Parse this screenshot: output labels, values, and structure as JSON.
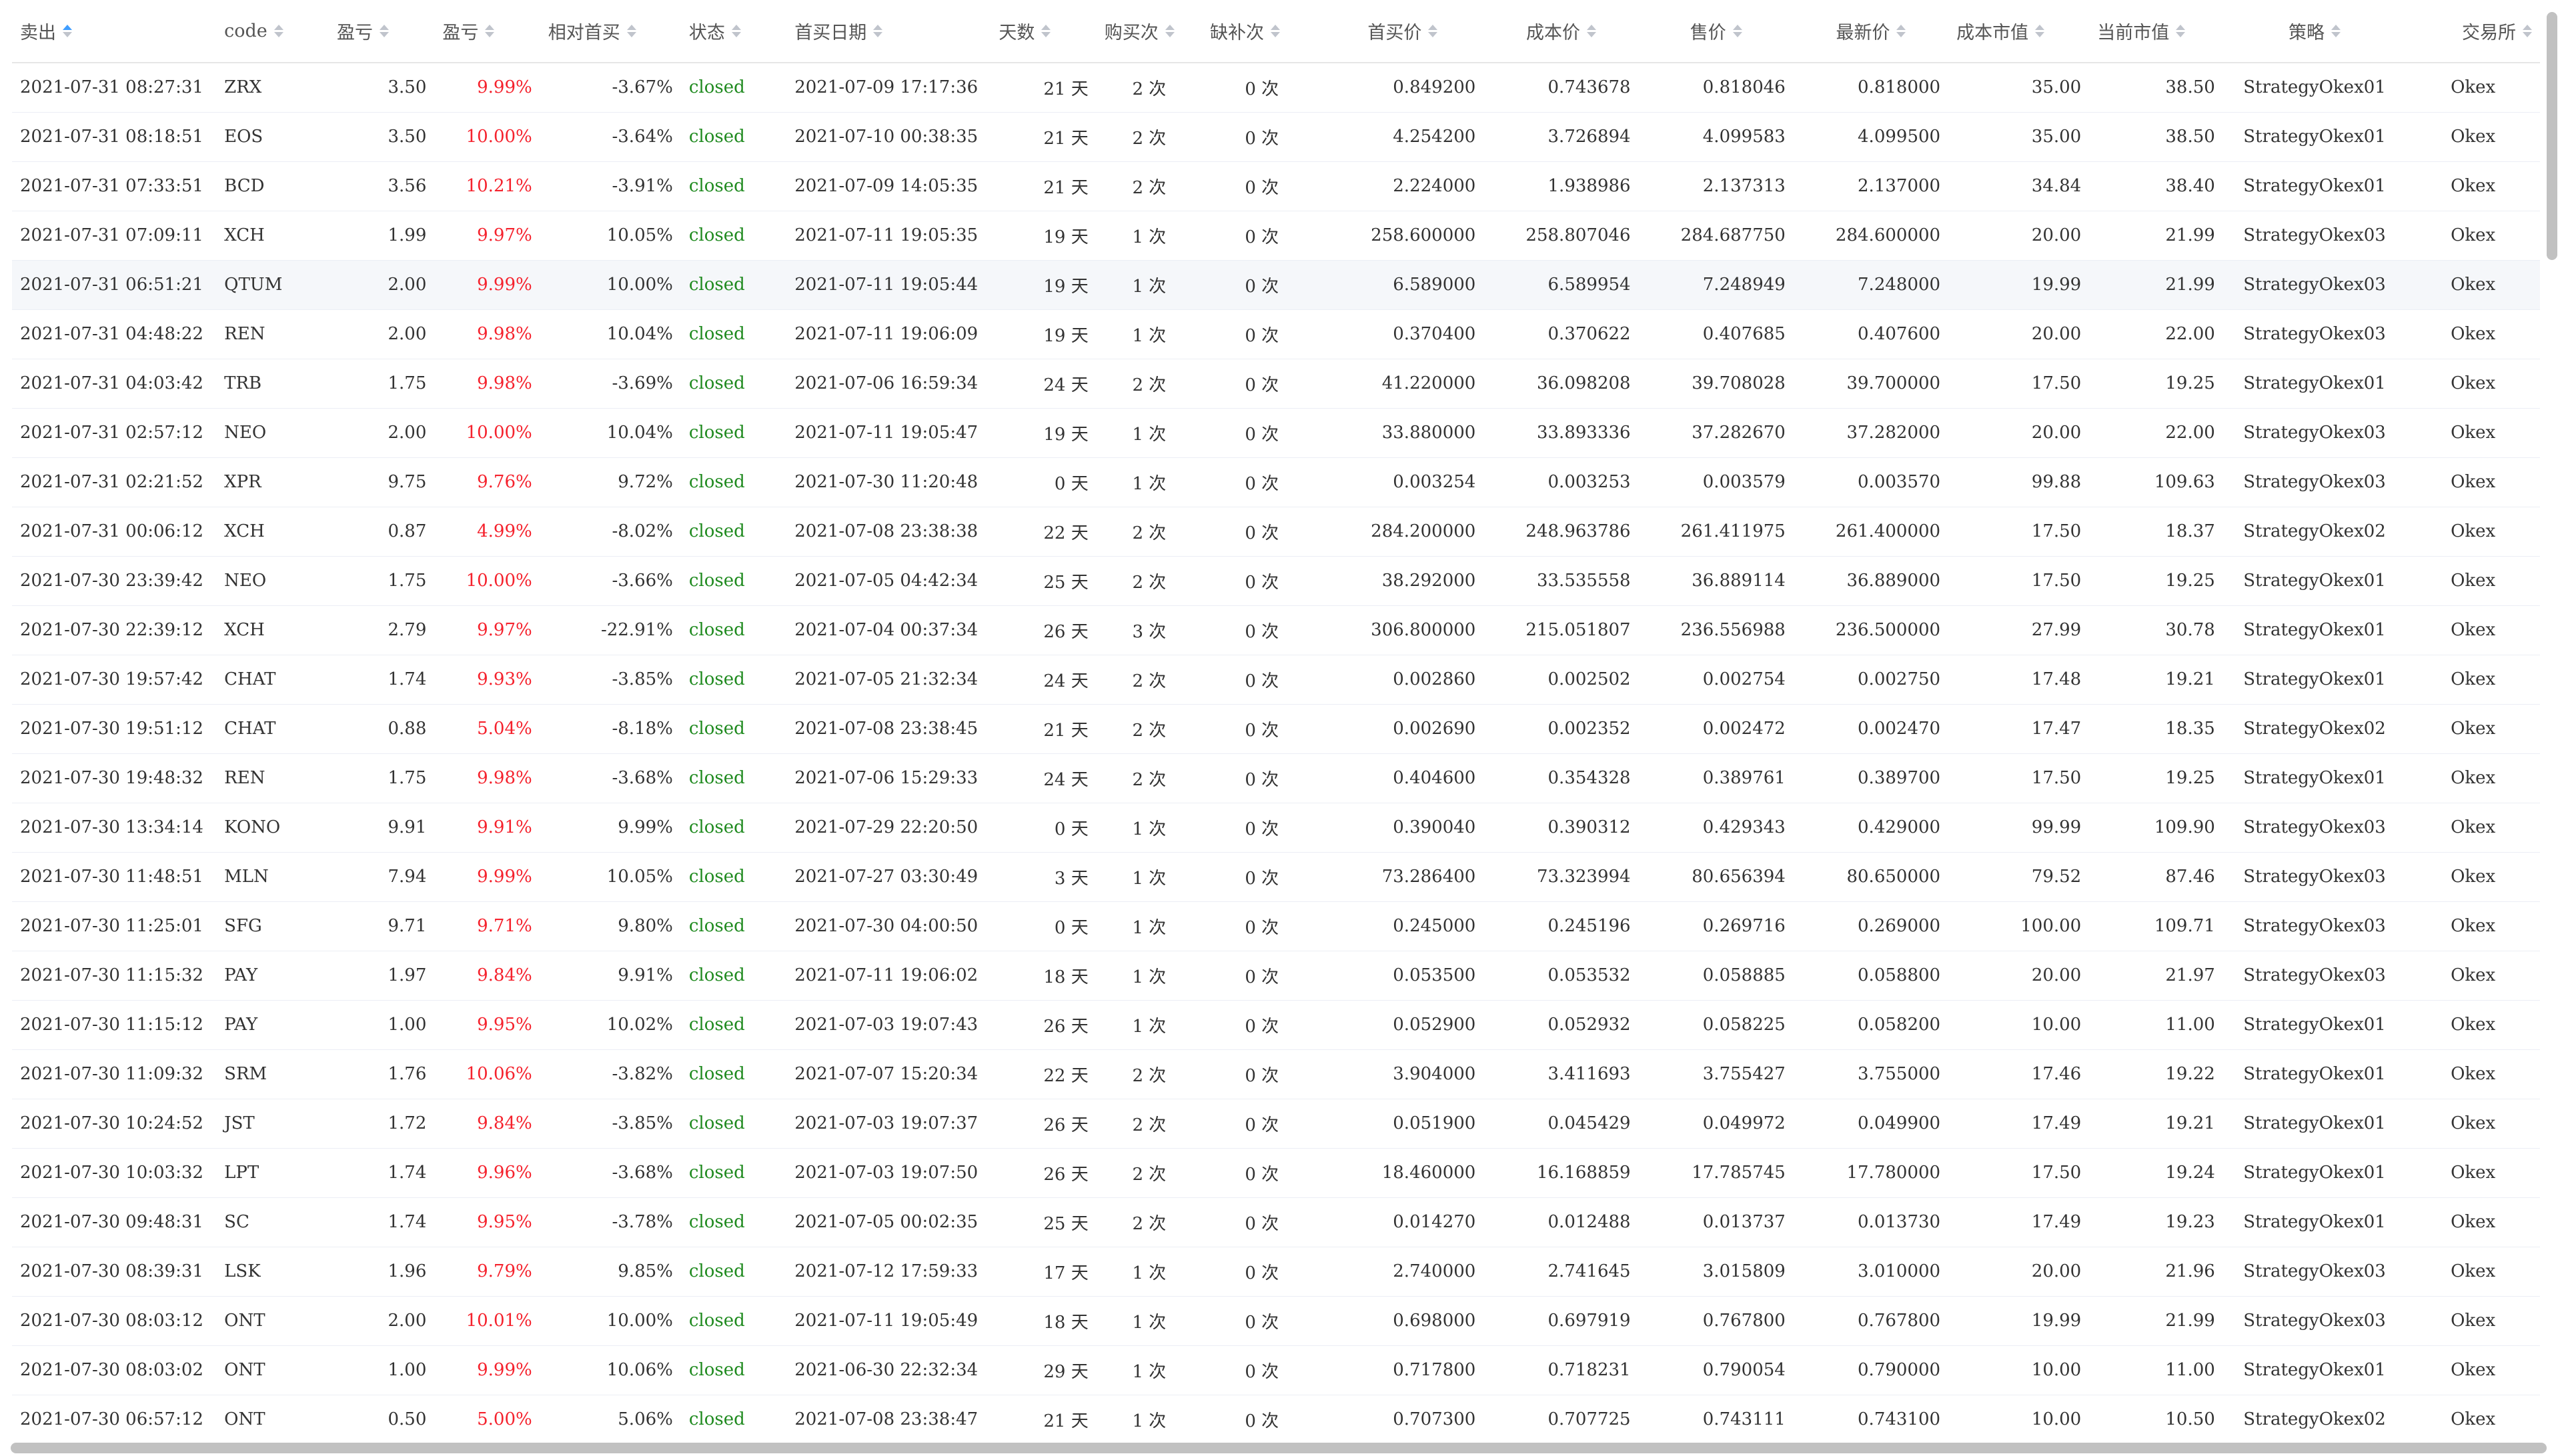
{
  "columns": [
    {
      "label": "卖出",
      "sort_active": true
    },
    {
      "label": "code",
      "sort_active": false
    },
    {
      "label": "盈亏",
      "sort_active": false
    },
    {
      "label": "盈亏",
      "sort_active": false
    },
    {
      "label": "相对首买",
      "sort_active": false
    },
    {
      "label": "状态",
      "sort_active": false
    },
    {
      "label": "首买日期",
      "sort_active": false
    },
    {
      "label": "天数",
      "sort_active": false
    },
    {
      "label": "购买次",
      "sort_active": false
    },
    {
      "label": "缺补次",
      "sort_active": false
    },
    {
      "label": "首买价",
      "sort_active": false
    },
    {
      "label": "成本价",
      "sort_active": false
    },
    {
      "label": "售价",
      "sort_active": false
    },
    {
      "label": "最新价",
      "sort_active": false
    },
    {
      "label": "成本市值",
      "sort_active": false
    },
    {
      "label": "当前市值",
      "sort_active": false
    },
    {
      "label": "策略",
      "sort_active": false
    },
    {
      "label": "交易所",
      "sort_active": false
    }
  ],
  "colors": {
    "profit_pct": "#f5222d",
    "status_closed": "#1f8a1f",
    "sort_active": "#409eff",
    "sort_inactive": "#c0c4cc"
  },
  "rows": [
    [
      "2021-07-31 08:27:31",
      "ZRX",
      "3.50",
      "9.99%",
      "-3.67%",
      "closed",
      "2021-07-09 17:17:36",
      "21 天",
      "2 次",
      "0 次",
      "0.849200",
      "0.743678",
      "0.818046",
      "0.818000",
      "35.00",
      "38.50",
      "StrategyOkex01",
      "Okex"
    ],
    [
      "2021-07-31 08:18:51",
      "EOS",
      "3.50",
      "10.00%",
      "-3.64%",
      "closed",
      "2021-07-10 00:38:35",
      "21 天",
      "2 次",
      "0 次",
      "4.254200",
      "3.726894",
      "4.099583",
      "4.099500",
      "35.00",
      "38.50",
      "StrategyOkex01",
      "Okex"
    ],
    [
      "2021-07-31 07:33:51",
      "BCD",
      "3.56",
      "10.21%",
      "-3.91%",
      "closed",
      "2021-07-09 14:05:35",
      "21 天",
      "2 次",
      "0 次",
      "2.224000",
      "1.938986",
      "2.137313",
      "2.137000",
      "34.84",
      "38.40",
      "StrategyOkex01",
      "Okex"
    ],
    [
      "2021-07-31 07:09:11",
      "XCH",
      "1.99",
      "9.97%",
      "10.05%",
      "closed",
      "2021-07-11 19:05:35",
      "19 天",
      "1 次",
      "0 次",
      "258.600000",
      "258.807046",
      "284.687750",
      "284.600000",
      "20.00",
      "21.99",
      "StrategyOkex03",
      "Okex"
    ],
    [
      "2021-07-31 06:51:21",
      "QTUM",
      "2.00",
      "9.99%",
      "10.00%",
      "closed",
      "2021-07-11 19:05:44",
      "19 天",
      "1 次",
      "0 次",
      "6.589000",
      "6.589954",
      "7.248949",
      "7.248000",
      "19.99",
      "21.99",
      "StrategyOkex03",
      "Okex"
    ],
    [
      "2021-07-31 04:48:22",
      "REN",
      "2.00",
      "9.98%",
      "10.04%",
      "closed",
      "2021-07-11 19:06:09",
      "19 天",
      "1 次",
      "0 次",
      "0.370400",
      "0.370622",
      "0.407685",
      "0.407600",
      "20.00",
      "22.00",
      "StrategyOkex03",
      "Okex"
    ],
    [
      "2021-07-31 04:03:42",
      "TRB",
      "1.75",
      "9.98%",
      "-3.69%",
      "closed",
      "2021-07-06 16:59:34",
      "24 天",
      "2 次",
      "0 次",
      "41.220000",
      "36.098208",
      "39.708028",
      "39.700000",
      "17.50",
      "19.25",
      "StrategyOkex01",
      "Okex"
    ],
    [
      "2021-07-31 02:57:12",
      "NEO",
      "2.00",
      "10.00%",
      "10.04%",
      "closed",
      "2021-07-11 19:05:47",
      "19 天",
      "1 次",
      "0 次",
      "33.880000",
      "33.893336",
      "37.282670",
      "37.282000",
      "20.00",
      "22.00",
      "StrategyOkex03",
      "Okex"
    ],
    [
      "2021-07-31 02:21:52",
      "XPR",
      "9.75",
      "9.76%",
      "9.72%",
      "closed",
      "2021-07-30 11:20:48",
      "0 天",
      "1 次",
      "0 次",
      "0.003254",
      "0.003253",
      "0.003579",
      "0.003570",
      "99.88",
      "109.63",
      "StrategyOkex03",
      "Okex"
    ],
    [
      "2021-07-31 00:06:12",
      "XCH",
      "0.87",
      "4.99%",
      "-8.02%",
      "closed",
      "2021-07-08 23:38:38",
      "22 天",
      "2 次",
      "0 次",
      "284.200000",
      "248.963786",
      "261.411975",
      "261.400000",
      "17.50",
      "18.37",
      "StrategyOkex02",
      "Okex"
    ],
    [
      "2021-07-30 23:39:42",
      "NEO",
      "1.75",
      "10.00%",
      "-3.66%",
      "closed",
      "2021-07-05 04:42:34",
      "25 天",
      "2 次",
      "0 次",
      "38.292000",
      "33.535558",
      "36.889114",
      "36.889000",
      "17.50",
      "19.25",
      "StrategyOkex01",
      "Okex"
    ],
    [
      "2021-07-30 22:39:12",
      "XCH",
      "2.79",
      "9.97%",
      "-22.91%",
      "closed",
      "2021-07-04 00:37:34",
      "26 天",
      "3 次",
      "0 次",
      "306.800000",
      "215.051807",
      "236.556988",
      "236.500000",
      "27.99",
      "30.78",
      "StrategyOkex01",
      "Okex"
    ],
    [
      "2021-07-30 19:57:42",
      "CHAT",
      "1.74",
      "9.93%",
      "-3.85%",
      "closed",
      "2021-07-05 21:32:34",
      "24 天",
      "2 次",
      "0 次",
      "0.002860",
      "0.002502",
      "0.002754",
      "0.002750",
      "17.48",
      "19.21",
      "StrategyOkex01",
      "Okex"
    ],
    [
      "2021-07-30 19:51:12",
      "CHAT",
      "0.88",
      "5.04%",
      "-8.18%",
      "closed",
      "2021-07-08 23:38:45",
      "21 天",
      "2 次",
      "0 次",
      "0.002690",
      "0.002352",
      "0.002472",
      "0.002470",
      "17.47",
      "18.35",
      "StrategyOkex02",
      "Okex"
    ],
    [
      "2021-07-30 19:48:32",
      "REN",
      "1.75",
      "9.98%",
      "-3.68%",
      "closed",
      "2021-07-06 15:29:33",
      "24 天",
      "2 次",
      "0 次",
      "0.404600",
      "0.354328",
      "0.389761",
      "0.389700",
      "17.50",
      "19.25",
      "StrategyOkex01",
      "Okex"
    ],
    [
      "2021-07-30 13:34:14",
      "KONO",
      "9.91",
      "9.91%",
      "9.99%",
      "closed",
      "2021-07-29 22:20:50",
      "0 天",
      "1 次",
      "0 次",
      "0.390040",
      "0.390312",
      "0.429343",
      "0.429000",
      "99.99",
      "109.90",
      "StrategyOkex03",
      "Okex"
    ],
    [
      "2021-07-30 11:48:51",
      "MLN",
      "7.94",
      "9.99%",
      "10.05%",
      "closed",
      "2021-07-27 03:30:49",
      "3 天",
      "1 次",
      "0 次",
      "73.286400",
      "73.323994",
      "80.656394",
      "80.650000",
      "79.52",
      "87.46",
      "StrategyOkex03",
      "Okex"
    ],
    [
      "2021-07-30 11:25:01",
      "SFG",
      "9.71",
      "9.71%",
      "9.80%",
      "closed",
      "2021-07-30 04:00:50",
      "0 天",
      "1 次",
      "0 次",
      "0.245000",
      "0.245196",
      "0.269716",
      "0.269000",
      "100.00",
      "109.71",
      "StrategyOkex03",
      "Okex"
    ],
    [
      "2021-07-30 11:15:32",
      "PAY",
      "1.97",
      "9.84%",
      "9.91%",
      "closed",
      "2021-07-11 19:06:02",
      "18 天",
      "1 次",
      "0 次",
      "0.053500",
      "0.053532",
      "0.058885",
      "0.058800",
      "20.00",
      "21.97",
      "StrategyOkex03",
      "Okex"
    ],
    [
      "2021-07-30 11:15:12",
      "PAY",
      "1.00",
      "9.95%",
      "10.02%",
      "closed",
      "2021-07-03 19:07:43",
      "26 天",
      "1 次",
      "0 次",
      "0.052900",
      "0.052932",
      "0.058225",
      "0.058200",
      "10.00",
      "11.00",
      "StrategyOkex01",
      "Okex"
    ],
    [
      "2021-07-30 11:09:32",
      "SRM",
      "1.76",
      "10.06%",
      "-3.82%",
      "closed",
      "2021-07-07 15:20:34",
      "22 天",
      "2 次",
      "0 次",
      "3.904000",
      "3.411693",
      "3.755427",
      "3.755000",
      "17.46",
      "19.22",
      "StrategyOkex01",
      "Okex"
    ],
    [
      "2021-07-30 10:24:52",
      "JST",
      "1.72",
      "9.84%",
      "-3.85%",
      "closed",
      "2021-07-03 19:07:37",
      "26 天",
      "2 次",
      "0 次",
      "0.051900",
      "0.045429",
      "0.049972",
      "0.049900",
      "17.49",
      "19.21",
      "StrategyOkex01",
      "Okex"
    ],
    [
      "2021-07-30 10:03:32",
      "LPT",
      "1.74",
      "9.96%",
      "-3.68%",
      "closed",
      "2021-07-03 19:07:50",
      "26 天",
      "2 次",
      "0 次",
      "18.460000",
      "16.168859",
      "17.785745",
      "17.780000",
      "17.50",
      "19.24",
      "StrategyOkex01",
      "Okex"
    ],
    [
      "2021-07-30 09:48:31",
      "SC",
      "1.74",
      "9.95%",
      "-3.78%",
      "closed",
      "2021-07-05 00:02:35",
      "25 天",
      "2 次",
      "0 次",
      "0.014270",
      "0.012488",
      "0.013737",
      "0.013730",
      "17.49",
      "19.23",
      "StrategyOkex01",
      "Okex"
    ],
    [
      "2021-07-30 08:39:31",
      "LSK",
      "1.96",
      "9.79%",
      "9.85%",
      "closed",
      "2021-07-12 17:59:33",
      "17 天",
      "1 次",
      "0 次",
      "2.740000",
      "2.741645",
      "3.015809",
      "3.010000",
      "20.00",
      "21.96",
      "StrategyOkex03",
      "Okex"
    ],
    [
      "2021-07-30 08:03:12",
      "ONT",
      "2.00",
      "10.01%",
      "10.00%",
      "closed",
      "2021-07-11 19:05:49",
      "18 天",
      "1 次",
      "0 次",
      "0.698000",
      "0.697919",
      "0.767800",
      "0.767800",
      "19.99",
      "21.99",
      "StrategyOkex03",
      "Okex"
    ],
    [
      "2021-07-30 08:03:02",
      "ONT",
      "1.00",
      "9.99%",
      "10.06%",
      "closed",
      "2021-06-30 22:32:34",
      "29 天",
      "1 次",
      "0 次",
      "0.717800",
      "0.718231",
      "0.790054",
      "0.790000",
      "10.00",
      "11.00",
      "StrategyOkex01",
      "Okex"
    ],
    [
      "2021-07-30 06:57:12",
      "ONT",
      "0.50",
      "5.00%",
      "5.06%",
      "closed",
      "2021-07-08 23:38:47",
      "21 天",
      "1 次",
      "0 次",
      "0.707300",
      "0.707725",
      "0.743111",
      "0.743100",
      "10.00",
      "10.50",
      "StrategyOkex02",
      "Okex"
    ]
  ],
  "hover_row": 4
}
